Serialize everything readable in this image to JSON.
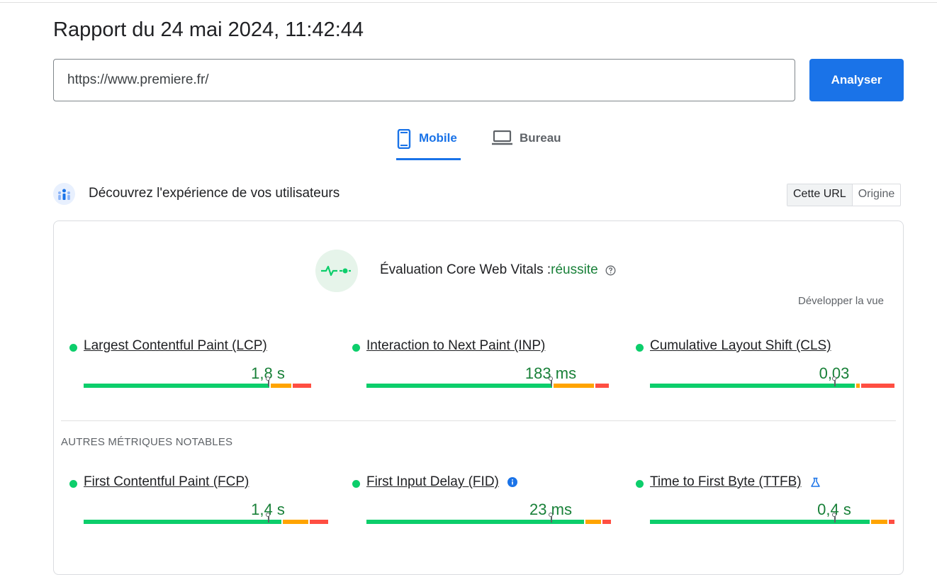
{
  "report": {
    "title": "Rapport du 24 mai 2024, 11:42:44"
  },
  "search": {
    "url_value": "https://www.premiere.fr/",
    "analyse_label": "Analyser"
  },
  "tabs": [
    {
      "label": "Mobile",
      "icon": "phone-icon",
      "active": true
    },
    {
      "label": "Bureau",
      "icon": "laptop-icon",
      "active": false
    }
  ],
  "section": {
    "title": "Découvrez l'expérience de vos utilisateurs",
    "icon": "crux-users-icon",
    "scope_options": [
      "Cette URL",
      "Origine"
    ],
    "scope_selected": "Cette URL"
  },
  "assessment": {
    "label": "Évaluation Core Web Vitals :",
    "result": "réussite",
    "expand_label": "Développer la vue",
    "icon": "vitals-pulse-icon"
  },
  "other_metrics_label": "AUTRES MÉTRIQUES NOTABLES",
  "colors": {
    "good": "#0cce6b",
    "needs_improvement": "#ffa400",
    "poor": "#ff4e42",
    "accent": "#1a73e8",
    "pass_text": "#188038"
  },
  "core_metrics": [
    {
      "name": "Largest Contentful Paint (LCP)",
      "value": "1,8 s",
      "distribution": {
        "good": 0.76,
        "needs_improvement": 0.09,
        "poor": 0.08
      },
      "marker": 0.75
    },
    {
      "name": "Interaction to Next Paint (INP)",
      "value": "183 ms",
      "distribution": {
        "good": 0.76,
        "needs_improvement": 0.17,
        "poor": 0.06
      },
      "marker": 0.75
    },
    {
      "name": "Cumulative Layout Shift (CLS)",
      "value": "0,03",
      "distribution": {
        "good": 0.84,
        "needs_improvement": 0.02,
        "poor": 0.14
      },
      "marker": 0.75
    }
  ],
  "other_metrics": [
    {
      "name": "First Contentful Paint (FCP)",
      "value": "1,4 s",
      "icon": null,
      "distribution": {
        "good": 0.81,
        "needs_improvement": 0.11,
        "poor": 0.08
      },
      "marker": 0.75
    },
    {
      "name": "First Input Delay (FID)",
      "value": "23 ms",
      "icon": "info-icon",
      "distribution": {
        "good": 0.89,
        "needs_improvement": 0.07,
        "poor": 0.04
      },
      "marker": 0.75
    },
    {
      "name": "Time to First Byte (TTFB)",
      "value": "0,4 s",
      "icon": "lab-flask-icon",
      "distribution": {
        "good": 0.9,
        "needs_improvement": 0.07,
        "poor": 0.03
      },
      "marker": 0.75
    }
  ]
}
